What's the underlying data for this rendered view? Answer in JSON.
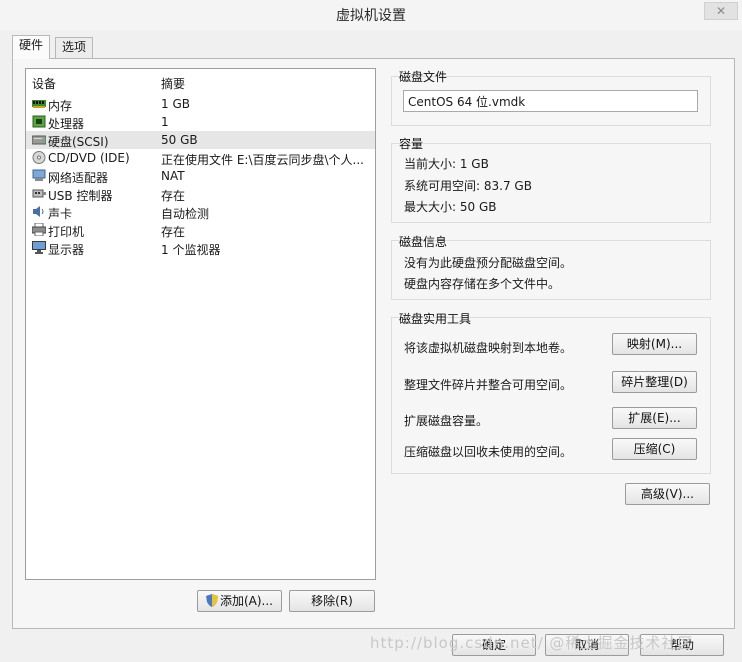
{
  "window": {
    "title": "虚拟机设置",
    "close_label": "✕"
  },
  "tabs": [
    {
      "label": "硬件"
    },
    {
      "label": "选项"
    }
  ],
  "devices": {
    "headers": {
      "device": "设备",
      "summary": "摘要"
    },
    "rows": [
      {
        "name": "内存",
        "summary": "1 GB",
        "icon": "memory-icon"
      },
      {
        "name": "处理器",
        "summary": "1",
        "icon": "processor-icon"
      },
      {
        "name": "硬盘(SCSI)",
        "summary": "50 GB",
        "icon": "hard-disk-icon",
        "selected": true
      },
      {
        "name": "CD/DVD (IDE)",
        "summary": "正在使用文件 E:\\百度云同步盘\\个人...",
        "icon": "cd-dvd-icon"
      },
      {
        "name": "网络适配器",
        "summary": "NAT",
        "icon": "network-adapter-icon"
      },
      {
        "name": "USB 控制器",
        "summary": "存在",
        "icon": "usb-icon"
      },
      {
        "name": "声卡",
        "summary": "自动检测",
        "icon": "sound-card-icon"
      },
      {
        "name": "打印机",
        "summary": "存在",
        "icon": "printer-icon"
      },
      {
        "name": "显示器",
        "summary": "1 个监视器",
        "icon": "display-icon"
      }
    ],
    "add_button": "添加(A)...",
    "remove_button": "移除(R)"
  },
  "disk_file": {
    "title": "磁盘文件",
    "value": "CentOS 64 位.vmdk"
  },
  "capacity": {
    "title": "容量",
    "current_size": "当前大小: 1 GB",
    "system_free": "系统可用空间: 83.7 GB",
    "max_size": "最大大小: 50 GB"
  },
  "disk_info": {
    "title": "磁盘信息",
    "line1": "没有为此硬盘预分配磁盘空间。",
    "line2": "硬盘内容存储在多个文件中。"
  },
  "disk_utilities": {
    "title": "磁盘实用工具",
    "items": [
      {
        "description": "将该虚拟机磁盘映射到本地卷。",
        "button": "映射(M)..."
      },
      {
        "description": "整理文件碎片并整合可用空间。",
        "button": "碎片整理(D)"
      },
      {
        "description": "扩展磁盘容量。",
        "button": "扩展(E)..."
      },
      {
        "description": "压缩磁盘以回收未使用的空间。",
        "button": "压缩(C)"
      }
    ]
  },
  "advanced_button": "高级(V)...",
  "footer": {
    "ok": "确定",
    "cancel": "取消",
    "help": "帮助"
  },
  "watermark": "http://blog.csdn.net/  @稀土掘金技术社区"
}
